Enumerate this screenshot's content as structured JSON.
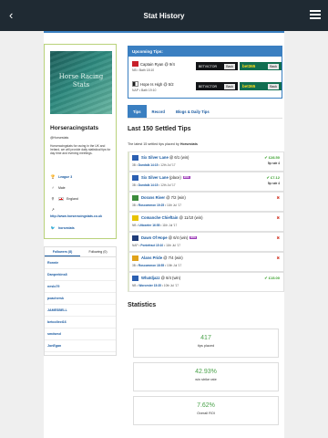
{
  "header": {
    "title": "Stat History",
    "back_glyph": "‹"
  },
  "profile": {
    "hero_text": "Horse Racing Stats",
    "username": "Horseracingstats",
    "handle": "@Horsestats",
    "bio": "Horseracingstats for racing in the UK and Ireland, we will provide daily statistical tips for day time and evening meetings.",
    "league": "League 3",
    "gender": "Male",
    "country": "England",
    "website": "http://www.horseracingstats.co.uk",
    "twitter": "horsestats"
  },
  "followers": {
    "tab_followers": "Followers (8)",
    "tab_following": "Following (0)",
    "items": [
      "Ronnie",
      "Danperkins8",
      "neslo79",
      "poachersk",
      "JAMESBELL",
      "betcollect16",
      "smdsmd",
      "JonEgan"
    ]
  },
  "upcoming": {
    "title": "Upcoming Tips:",
    "tips": [
      {
        "horse": "Captain Ryan @ 9/4",
        "sub": "NB • Bath 18:10",
        "silk": "#c8202a"
      },
      {
        "horse": "Hope Is High @ 5/2",
        "sub": "NAP • Bath 19:10",
        "silk": "#1c1c1c"
      }
    ],
    "betvictor": "BETVICTOR",
    "bet365": "bet365",
    "back_label": "Back"
  },
  "tabs": [
    {
      "label": "Tips",
      "active": true
    },
    {
      "label": "Record",
      "active": false
    },
    {
      "label": "Blogs & Daily Tips",
      "active": false
    }
  ],
  "settled": {
    "title": "Last 150 Settled Tips",
    "subtitle_prefix": "The latest 15 settled tips placed by ",
    "subtitle_user": "Horsestats",
    "tips": [
      {
        "horse": "Six Silver Lane",
        "odds": "@ 6/1 (win)",
        "info_pre": "3B • ",
        "course": "Dundalk 14:15",
        "info_post": " • 12th Jul '17",
        "result": "✔ £28.50",
        "rule": "5p rule 4",
        "win": true,
        "tag": "",
        "silk": "#2b5fb2"
      },
      {
        "horse": "Six Silver Lane",
        "odds": "(place)",
        "info_pre": "3B • ",
        "course": "Dundalk 14:15",
        "info_post": " • 12th Jul '17",
        "result": "✔ £7.12",
        "rule": "5p rule 4",
        "win": true,
        "tag": "BOG",
        "silk": "#2b5fb2"
      },
      {
        "horse": "Dorans River",
        "odds": "@ 7/2 (win)",
        "info_pre": "3B • ",
        "course": "Roscommon 19:25",
        "info_post": " • 11th Jul '17",
        "result": "✖",
        "rule": "",
        "win": false,
        "tag": "",
        "silk": "#3b8b3b"
      },
      {
        "horse": "Comanche Chieftain",
        "odds": "@ 11/10 (win)",
        "info_pre": "NB • ",
        "course": "Uttoxeter 16:55",
        "info_post": " • 11th Jul '17",
        "result": "✖",
        "rule": "",
        "win": false,
        "tag": "",
        "silk": "#e8c300"
      },
      {
        "horse": "Dawn Of Hope",
        "odds": "@ 6/4 (win)",
        "info_pre": "NAP • ",
        "course": "Pontefract 15:10",
        "info_post": " • 11th Jul '17",
        "result": "✖",
        "rule": "",
        "win": false,
        "tag": "BOG",
        "silk": "#1f3b7a"
      },
      {
        "horse": "Alans Pride",
        "odds": "@ 7/4 (win)",
        "info_pre": "3B • ",
        "course": "Roscommon 18:55",
        "info_post": " • 10th Jul '17",
        "result": "✖",
        "rule": "",
        "win": false,
        "tag": "",
        "silk": "#e0a21a"
      },
      {
        "horse": "Whatdjazz",
        "odds": "@ 6/4 (win)",
        "info_pre": "NB • ",
        "course": "Worcester 15:35",
        "info_post": " • 10th Jul '17",
        "result": "✔ £15.00",
        "rule": "",
        "win": true,
        "tag": "",
        "silk": "#2b5fb2"
      }
    ]
  },
  "statistics": {
    "title": "Statistics",
    "cards": [
      {
        "value": "417",
        "label": "tips placed"
      },
      {
        "value": "42.93%",
        "label": "win strike rate"
      },
      {
        "value": "7.62%",
        "label": "Overall ROI"
      }
    ]
  },
  "colors": {
    "accent": "#3a7fc1",
    "win": "#3aa12c",
    "lose": "#d23a2a",
    "topbar": "#1f2a33"
  }
}
